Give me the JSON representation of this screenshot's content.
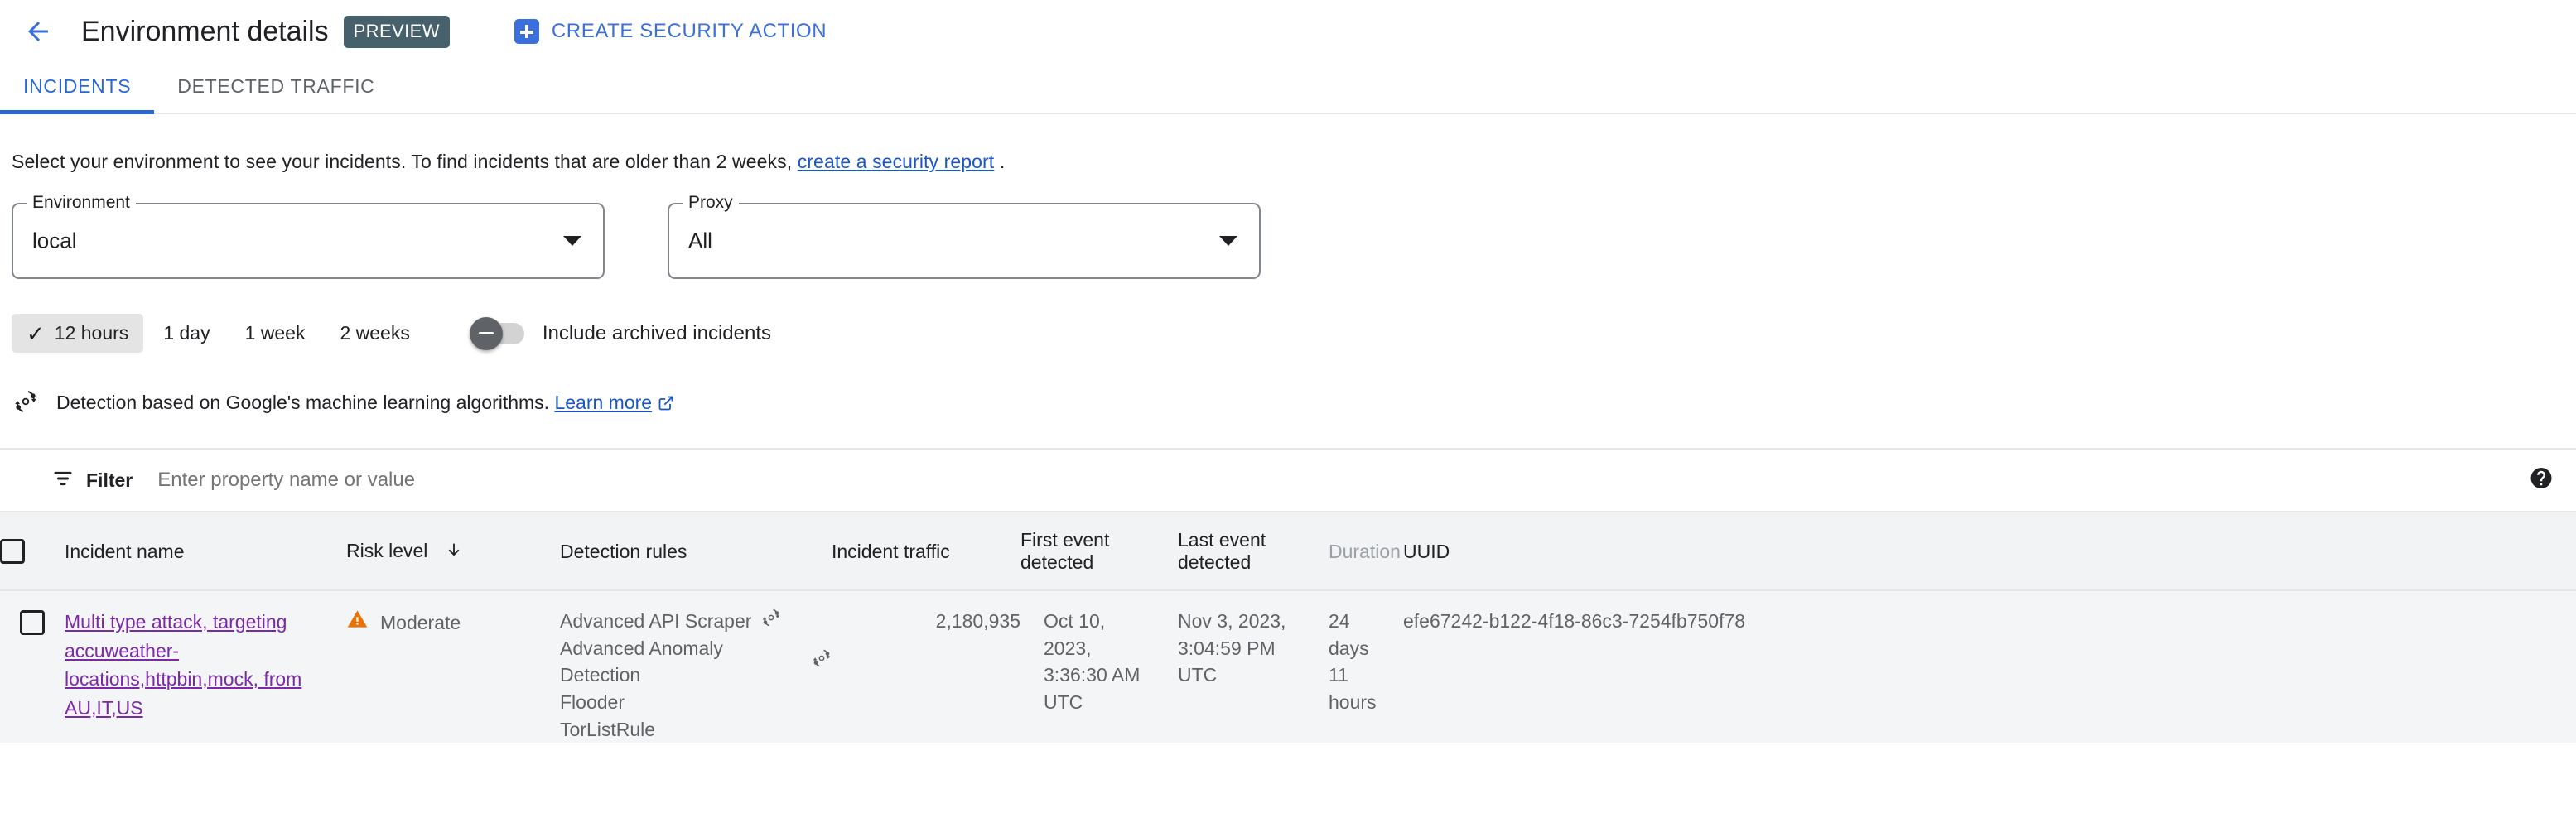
{
  "header": {
    "back_icon": "arrow-left-icon",
    "title": "Environment details",
    "badge": "PREVIEW",
    "create_action_label": "CREATE SECURITY ACTION",
    "create_action_icon": "plus-box-icon"
  },
  "tabs": [
    {
      "label": "INCIDENTS",
      "active": true
    },
    {
      "label": "DETECTED TRAFFIC",
      "active": false
    }
  ],
  "description": {
    "prefix": "Select your environment to see your incidents. To find incidents that are older than 2 weeks,",
    "link": "create a security report",
    "suffix": "."
  },
  "filters": {
    "environment": {
      "label": "Environment",
      "value": "local"
    },
    "proxy": {
      "label": "Proxy",
      "value": "All"
    },
    "ranges": [
      {
        "label": "12 hours",
        "selected": true,
        "check": "✓"
      },
      {
        "label": "1 day",
        "selected": false
      },
      {
        "label": "1 week",
        "selected": false
      },
      {
        "label": "2 weeks",
        "selected": false
      }
    ],
    "archived_toggle": {
      "label": "Include archived incidents",
      "on": false
    }
  },
  "ml_note": {
    "icon": "model-training-icon",
    "text": "Detection based on Google's machine learning algorithms.",
    "link": "Learn more",
    "link_icon": "open-in-new-icon"
  },
  "filter_bar": {
    "icon": "filter-list-icon",
    "label": "Filter",
    "placeholder": "Enter property name or value",
    "help_icon": "help-filled-icon"
  },
  "table": {
    "select_all_checkbox": "select-all-checkbox",
    "columns": [
      {
        "key": "name",
        "label": "Incident name",
        "muted": false
      },
      {
        "key": "risk",
        "label": "Risk level",
        "muted": false,
        "sort": "↓"
      },
      {
        "key": "rules",
        "label": "Detection rules",
        "muted": false
      },
      {
        "key": "traffic",
        "label": "Incident traffic",
        "muted": false
      },
      {
        "key": "first",
        "label": "First event detected",
        "muted": false
      },
      {
        "key": "last",
        "label": "Last event detected",
        "muted": false
      },
      {
        "key": "duration",
        "label": "Duration",
        "muted": true
      },
      {
        "key": "uuid",
        "label": "UUID",
        "muted": false
      }
    ],
    "rows": [
      {
        "name": "Multi type attack, targeting accuweather-locations,httpbin,mock, from AU,IT,US",
        "risk": "Moderate",
        "risk_icon": "warning-triangle-icon",
        "rules": [
          {
            "name": "Advanced API Scraper",
            "ml": true
          },
          {
            "name": "Advanced Anomaly Detection",
            "ml": true
          },
          {
            "name": "Flooder",
            "ml": false
          },
          {
            "name": "TorListRule",
            "ml": false
          }
        ],
        "traffic": "2,180,935",
        "first_event": "Oct 10, 2023, 3:36:30 AM UTC",
        "last_event": "Nov 3, 2023, 3:04:59 PM UTC",
        "duration": "24 days 11 hours",
        "uuid": "efe67242-b122-4f18-86c3-7254fb750f78"
      }
    ]
  },
  "colors": {
    "accent_blue": "#3b6fdb",
    "link_blue": "#1a56c5",
    "visited_purple": "#7b29a8",
    "warning_orange": "#e8710a",
    "badge_slate": "#46616b",
    "header_grey": "#f1f3f4"
  }
}
